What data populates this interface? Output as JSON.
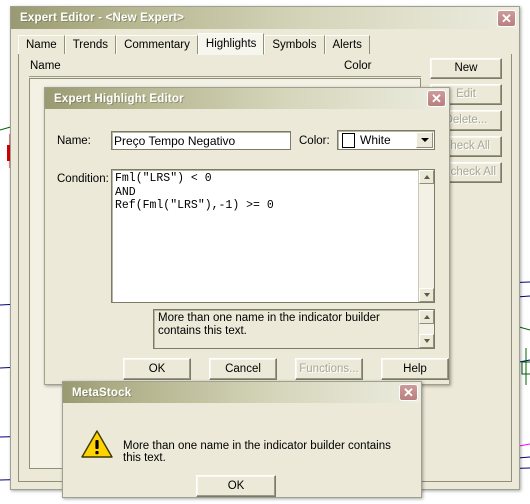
{
  "expert_editor": {
    "title": "Expert Editor - <New Expert>",
    "close_label": "✕",
    "tabs": [
      {
        "label": "Name",
        "active": false
      },
      {
        "label": "Trends",
        "active": false
      },
      {
        "label": "Commentary",
        "active": false
      },
      {
        "label": "Highlights",
        "active": true
      },
      {
        "label": "Symbols",
        "active": false
      },
      {
        "label": "Alerts",
        "active": false
      }
    ],
    "columns": {
      "name": "Name",
      "color": "Color"
    },
    "side_buttons": [
      {
        "label": "New",
        "disabled": false
      },
      {
        "label": "Edit",
        "disabled": true
      },
      {
        "label": "Delete...",
        "disabled": true
      },
      {
        "label": "Check All",
        "disabled": true
      },
      {
        "label": "Uncheck All",
        "disabled": true
      }
    ]
  },
  "highlight_editor": {
    "title": "Expert Highlight Editor",
    "close_label": "✕",
    "name_label": "Name:",
    "name_value": "Preço Tempo Negativo",
    "color_label": "Color:",
    "color_value": "White",
    "color_hex": "#ffffff",
    "condition_label": "Condition:",
    "condition_value": "Fml(\"LRS\") < 0\nAND\nRef(Fml(\"LRS\"),-1) >= 0",
    "status_text": "More than one name in the indicator builder contains this text.",
    "buttons": [
      {
        "label": "OK",
        "disabled": false
      },
      {
        "label": "Cancel",
        "disabled": false
      },
      {
        "label": "Functions...",
        "disabled": true
      },
      {
        "label": "Help",
        "disabled": false
      }
    ]
  },
  "metastock_dialog": {
    "title": "MetaStock",
    "close_label": "✕",
    "icon": "warning-triangle-icon",
    "message": "More than one name in the indicator builder contains this text.",
    "ok_label": "OK"
  },
  "colors": {
    "titlebar_accent": "#9a9a72",
    "dialog_face": "#ece9d8",
    "close_button": "#bf8a8a",
    "warning_yellow": "#ffd200",
    "candle_up": "#008000",
    "candle_down": "#d00000",
    "trendline_blue": "#000080",
    "trendline_magenta": "#ff00ff"
  }
}
